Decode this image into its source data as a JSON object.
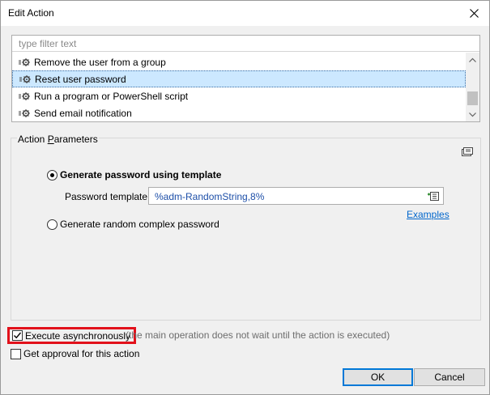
{
  "window": {
    "title": "Edit Action"
  },
  "action_list": {
    "filter_placeholder": "type filter text",
    "items": [
      {
        "label": "Remove the user from a group",
        "selected": false
      },
      {
        "label": "Reset user password",
        "selected": true
      },
      {
        "label": "Run a program or PowerShell script",
        "selected": false
      },
      {
        "label": "Send email notification",
        "selected": false
      }
    ],
    "scroll_position": 0.55
  },
  "parameters": {
    "legend": "Action Parameters",
    "legend_mnemonic": "P",
    "options": [
      {
        "label": "Generate password using template",
        "checked": true
      },
      {
        "label": "Generate random complex password",
        "checked": false
      }
    ],
    "template_label": "Password template:",
    "template_value": "%adm-RandomString,8%",
    "examples_link": "Examples"
  },
  "execute_async": {
    "label": "Execute asynchronously",
    "checked": true,
    "hint": "(the main operation does not wait until the action is executed)"
  },
  "approval": {
    "label": "Get approval for this action",
    "checked": false
  },
  "buttons": {
    "ok": "OK",
    "cancel": "Cancel"
  },
  "colors": {
    "selection": "#cce8ff",
    "link": "#0066cc",
    "highlight": "#e2111b",
    "default_button": "#0078d7"
  }
}
